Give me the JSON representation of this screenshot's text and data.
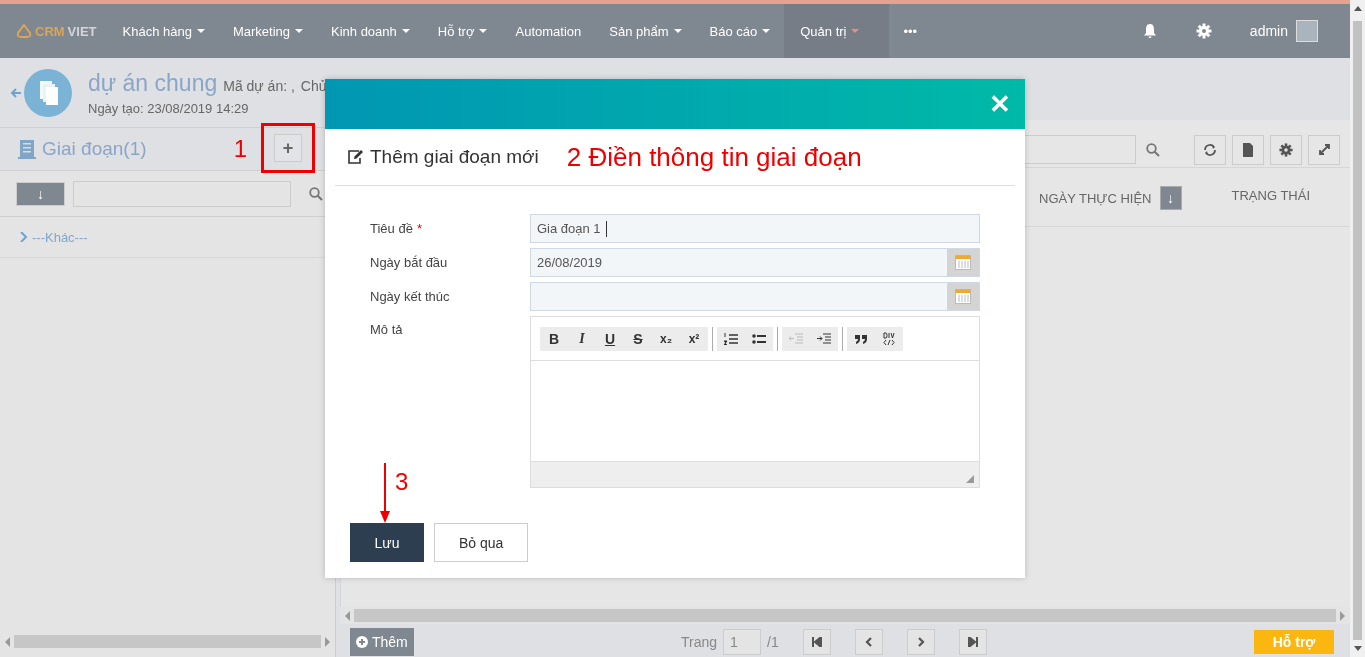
{
  "nav": {
    "logo_strong": "CRM",
    "logo_light": "VIET",
    "items": [
      {
        "label": "Khách hàng",
        "caret": true,
        "selected": false
      },
      {
        "label": "Marketing",
        "caret": true,
        "selected": false
      },
      {
        "label": "Kinh doanh",
        "caret": true,
        "selected": false
      },
      {
        "label": "Hỗ trợ",
        "caret": true,
        "selected": false
      },
      {
        "label": "Automation",
        "caret": false,
        "selected": false
      },
      {
        "label": "Sản phẩm",
        "caret": true,
        "selected": false
      },
      {
        "label": "Báo cáo",
        "caret": true,
        "selected": false
      },
      {
        "label": "Quản trị",
        "caret": true,
        "selected": true
      },
      {
        "label": "•••",
        "caret": false,
        "selected": false
      }
    ],
    "user": "admin"
  },
  "header": {
    "title": "dự án chung",
    "code_label": "Mã dự án: ,",
    "owner_label": "Chủ",
    "created": "Ngày tạo: 23/08/2019 14:29"
  },
  "left": {
    "title": "Giai đoạn(1)",
    "add_button": "+",
    "sort_button": "↓",
    "tree": [
      {
        "label": "---Khác---",
        "expanded": false
      }
    ]
  },
  "right": {
    "columns": [
      {
        "label": "NGÀY THỰC HIỆN",
        "sortable": true
      },
      {
        "label": "TRẠNG THÁI",
        "sortable": false
      }
    ],
    "sort_glyph": "↓",
    "footer": {
      "add_button": "Thêm",
      "page_label": "Trang",
      "page": "1",
      "total": "/1",
      "help_button": "Hỗ trợ"
    }
  },
  "modal": {
    "title": "Thêm giai đoạn mới",
    "close": "✕",
    "fields": [
      {
        "kind": "text",
        "label": "Tiêu đề",
        "required": true,
        "value": "Gia đoạn 1"
      },
      {
        "kind": "date",
        "label": "Ngày bắt đầu",
        "required": false,
        "value": "26/08/2019"
      },
      {
        "kind": "date",
        "label": "Ngày kết thúc",
        "required": false
      },
      {
        "kind": "editor",
        "label": "Mô tả",
        "required": false
      }
    ],
    "required_mark": "*",
    "toolbar": [
      [
        {
          "kind": "bold",
          "glyph": "B",
          "disabled": false
        },
        {
          "kind": "italic",
          "glyph": "I",
          "disabled": false
        },
        {
          "kind": "underline",
          "glyph": "U",
          "disabled": false
        },
        {
          "kind": "strike",
          "glyph": "S",
          "disabled": false
        },
        {
          "kind": "sub",
          "glyph": "x₂",
          "disabled": false
        },
        {
          "kind": "sup",
          "glyph": "x²",
          "disabled": false
        }
      ],
      [
        {
          "kind": "ol",
          "disabled": false
        },
        {
          "kind": "ul",
          "disabled": false
        }
      ],
      [
        {
          "kind": "outdent",
          "disabled": true
        },
        {
          "kind": "indent",
          "disabled": false
        }
      ],
      [
        {
          "kind": "quote",
          "disabled": false
        },
        {
          "kind": "div",
          "disabled": false
        }
      ]
    ],
    "buttons": [
      {
        "kind": "primary",
        "label": "Lưu"
      },
      {
        "kind": "secondary",
        "label": "Bỏ qua"
      }
    ]
  },
  "annotations": {
    "step1": "1",
    "step2": "2 Điền thông tin giai đoạn",
    "step3": "3"
  }
}
